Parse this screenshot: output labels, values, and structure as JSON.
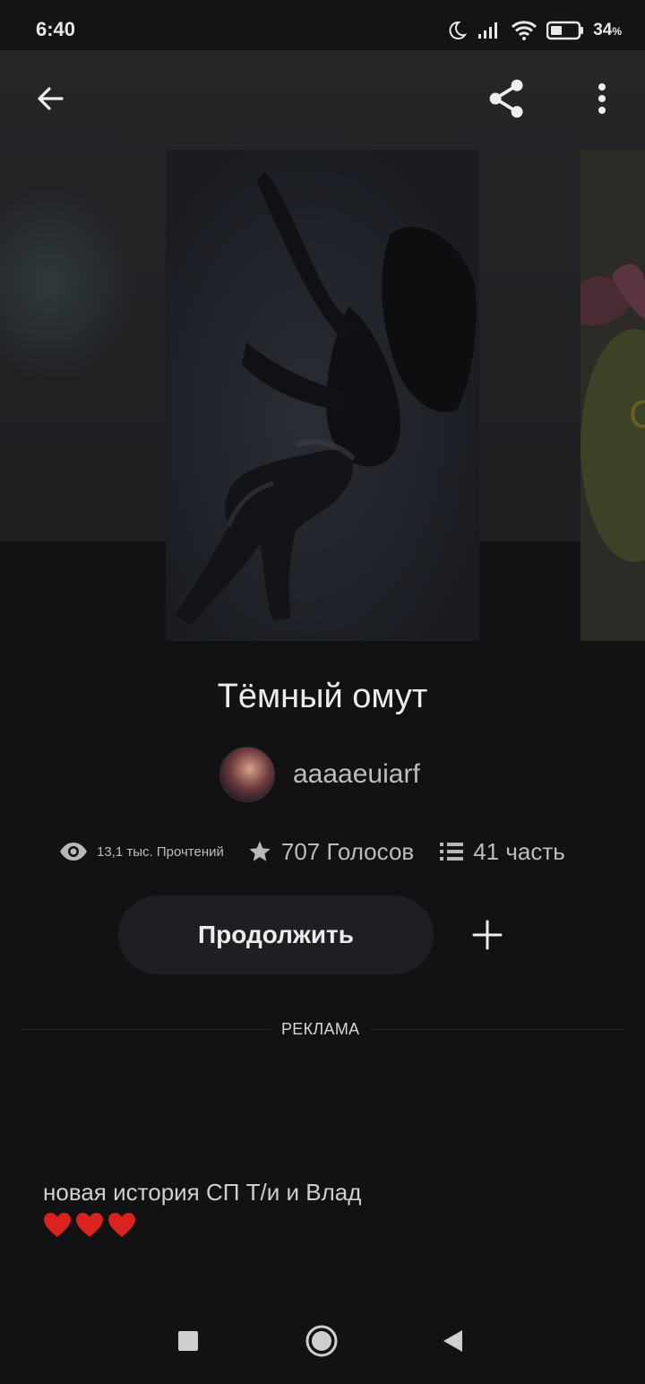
{
  "status_bar": {
    "time": "6:40",
    "battery": "34",
    "battery_unit": "%"
  },
  "header": {
    "back_icon": "arrow-left-icon",
    "share_icon": "share-icon",
    "more_icon": "more-vertical-icon"
  },
  "story": {
    "title": "Тёмный омут",
    "author": "aaaaeuiarf",
    "reads": "13,1 тыс. Прочтений",
    "votes": "707 Голосов",
    "parts": "41 часть",
    "continue_label": "Продолжить",
    "ad_label": "РЕКЛАМА",
    "description": "новая история СП Т/и и Влад"
  },
  "colors": {
    "background": "#121114",
    "hero": "#232326",
    "button": "#1f1e22",
    "heart": "#d9231f"
  }
}
